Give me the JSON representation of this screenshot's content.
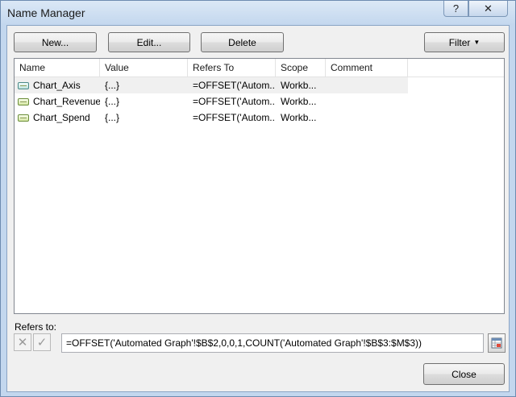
{
  "window": {
    "title": "Name Manager",
    "help_glyph": "?",
    "close_glyph": "✕"
  },
  "toolbar": {
    "new_label": "New...",
    "edit_label": "Edit...",
    "delete_label": "Delete",
    "filter_label": "Filter",
    "filter_caret": "▼"
  },
  "table": {
    "columns": [
      "Name",
      "Value",
      "Refers To",
      "Scope",
      "Comment"
    ],
    "rows": [
      {
        "name": "Chart_Axis",
        "value": "{...}",
        "refers_to": "=OFFSET('Autom...",
        "scope": "Workb...",
        "comment": "",
        "icon": "named-range-icon",
        "selected": true
      },
      {
        "name": "Chart_Revenue",
        "value": "{...}",
        "refers_to": "=OFFSET('Autom...",
        "scope": "Workb...",
        "comment": "",
        "icon": "named-range-icon",
        "selected": false
      },
      {
        "name": "Chart_Spend",
        "value": "{...}",
        "refers_to": "=OFFSET('Autom...",
        "scope": "Workb...",
        "comment": "",
        "icon": "named-range-icon",
        "selected": false
      }
    ]
  },
  "refers_to": {
    "label": "Refers to:",
    "value": "=OFFSET('Automated Graph'!$B$2,0,0,1,COUNT('Automated Graph'!$B$3:$M$3))",
    "cancel_glyph": "✕",
    "confirm_glyph": "✓"
  },
  "footer": {
    "close_label": "Close"
  }
}
